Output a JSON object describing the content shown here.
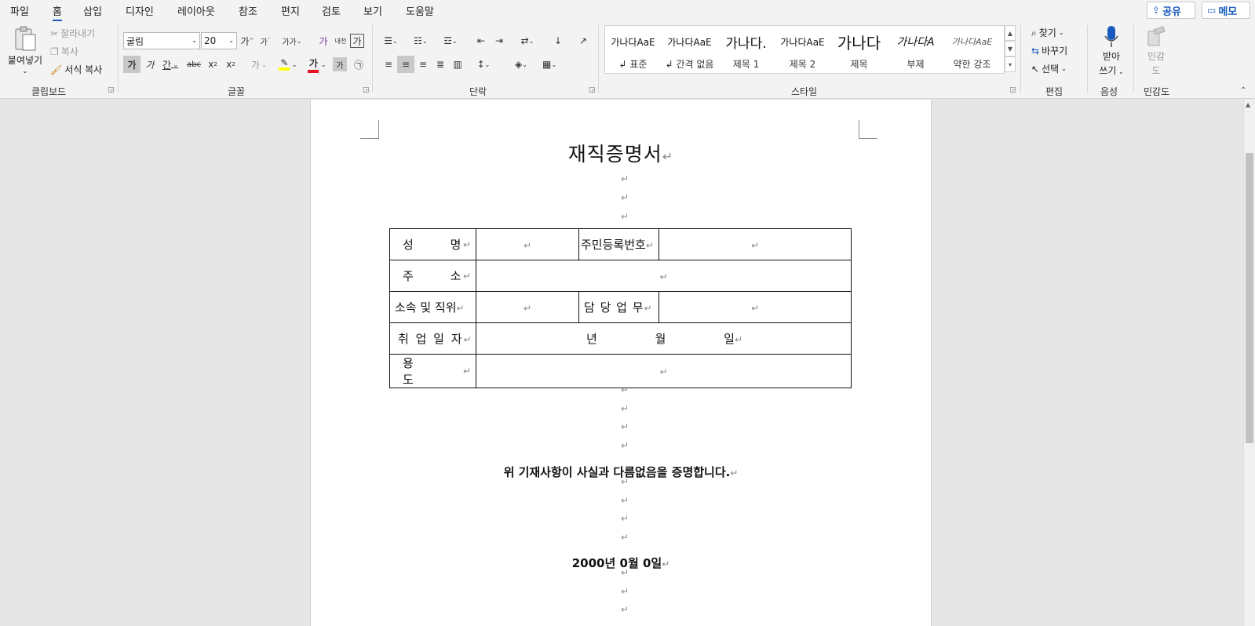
{
  "menu": {
    "items": [
      "파일",
      "홈",
      "삽입",
      "디자인",
      "레이아웃",
      "참조",
      "편지",
      "검토",
      "보기",
      "도움말"
    ],
    "active_index": 1,
    "share_label": "공유",
    "memo_label": "메모"
  },
  "ribbon": {
    "clipboard": {
      "paste_label": "붙여넣기",
      "cut_label": "잘라내기",
      "copy_label": "복사",
      "format_painter_label": "서식 복사",
      "group_label": "클립보드"
    },
    "font": {
      "font_name": "굴림",
      "font_size": "20",
      "grow_label": "가",
      "shrink_label": "가",
      "case_label": "가가",
      "clear_label": "가",
      "phonetic_label": "내천",
      "border_char_label": "가",
      "bold_label": "가",
      "italic_label": "가",
      "underline_label": "간",
      "strike_label": "abc",
      "sub_label": "x",
      "sup_label": "x",
      "effects_label": "가",
      "highlight_label": "가",
      "color_label": "가",
      "shade_label": "가",
      "enclose_label": "㉠",
      "group_label": "글꼴",
      "highlight_color": "#ffff00",
      "font_color": "#e81123"
    },
    "paragraph": {
      "group_label": "단락"
    },
    "styles": {
      "items": [
        {
          "sample": "가나다AaE",
          "name": "표준",
          "mark": "↲"
        },
        {
          "sample": "가나다AaE",
          "name": "간격 없음",
          "mark": "↲"
        },
        {
          "sample": "가나다.",
          "name": "제목 1",
          "mark": ""
        },
        {
          "sample": "가나다AaE",
          "name": "제목 2",
          "mark": ""
        },
        {
          "sample": "가나다",
          "name": "제목",
          "mark": ""
        },
        {
          "sample": "가나다A",
          "name": "부제",
          "mark": ""
        },
        {
          "sample": "가나다AaE",
          "name": "약한 강조",
          "mark": ""
        }
      ],
      "group_label": "스타일"
    },
    "editing": {
      "find_label": "찾기",
      "replace_label": "바꾸기",
      "select_label": "선택",
      "group_label": "편집"
    },
    "voice": {
      "dictate_label_1": "받아",
      "dictate_label_2": "쓰기",
      "group_label": "음성"
    },
    "sensitivity": {
      "label_1": "민감",
      "label_2": "도",
      "group_label": "민감도"
    }
  },
  "document": {
    "title": "재직증명서",
    "table": {
      "r1": {
        "c1": "성 명",
        "c3": "주민등록번호"
      },
      "r2": {
        "c1": "주 소"
      },
      "r3": {
        "c1": "소속 및 직위",
        "c3": "담 당 업 무"
      },
      "r4": {
        "c1": "취 업 일 자",
        "year": "년",
        "month": "월",
        "day": "일"
      },
      "r5": {
        "c1": "용 도"
      }
    },
    "certification": "위 기재사항이 사실과 다름없음을 증명합니다.",
    "date_line": "2000년 0월 0일",
    "para_mark": "↵"
  }
}
